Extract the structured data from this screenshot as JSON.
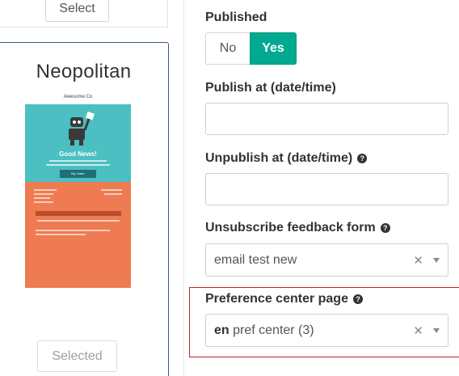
{
  "theme_panel": {
    "select_button_label": "Select",
    "theme_name": "Neopolitan",
    "preview": {
      "company": "Awesome Co",
      "headline": "Good News!",
      "button_label": "My Order",
      "colors": {
        "teal": "#4bbfc1",
        "orange": "#ef7b53"
      }
    },
    "selected_button_label": "Selected"
  },
  "form": {
    "published": {
      "label": "Published",
      "no_label": "No",
      "yes_label": "Yes",
      "value": "Yes",
      "active_color": "#00a98f"
    },
    "publish_at": {
      "label": "Publish at (date/time)",
      "value": ""
    },
    "unpublish_at": {
      "label": "Unpublish at (date/time)",
      "value": ""
    },
    "unsubscribe_form": {
      "label": "Unsubscribe feedback form",
      "value": "email test new"
    },
    "preference_center": {
      "label": "Preference center page",
      "lang": "en",
      "value": "pref center (3)"
    }
  },
  "highlight_color": "#c0242b"
}
